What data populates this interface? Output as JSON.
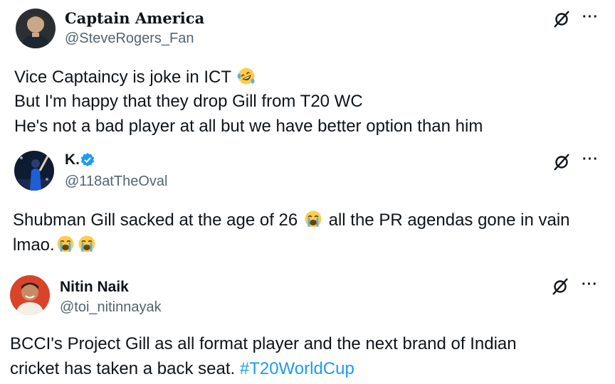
{
  "tweets": [
    {
      "name": "Captain America",
      "handle": "@SteveRogers_Fan",
      "lines": [
        "Vice Captaincy is joke in ICT",
        "But I'm happy that they drop Gill from T20 WC",
        "He's not a bad player at all but we have better option than him"
      ],
      "emoji": "rofl-emoji"
    },
    {
      "name": "K.",
      "handle": "@118atTheOval",
      "line1_a": "Shubman Gill sacked at the age of 26",
      "line1_b": "all the PR agendas gone in vain",
      "line2": "lmao."
    },
    {
      "name": "Nitin Naik",
      "handle": "@toi_nitinnayak",
      "line1": "BCCI's Project Gill as all format player and the next brand of Indian",
      "line2": "cricket has taken a back seat.",
      "hashtag": "#T20WorldCup"
    }
  ],
  "more_label": "···",
  "colors": {
    "text": "#0f1419",
    "secondary": "#536471",
    "link": "#1d9bf0",
    "verified": "#1d9bf0"
  },
  "icons": {
    "grok": "grok-icon",
    "more": "more-icon",
    "verified": "verified-badge-icon",
    "crying": "loudly-crying-emoji"
  }
}
